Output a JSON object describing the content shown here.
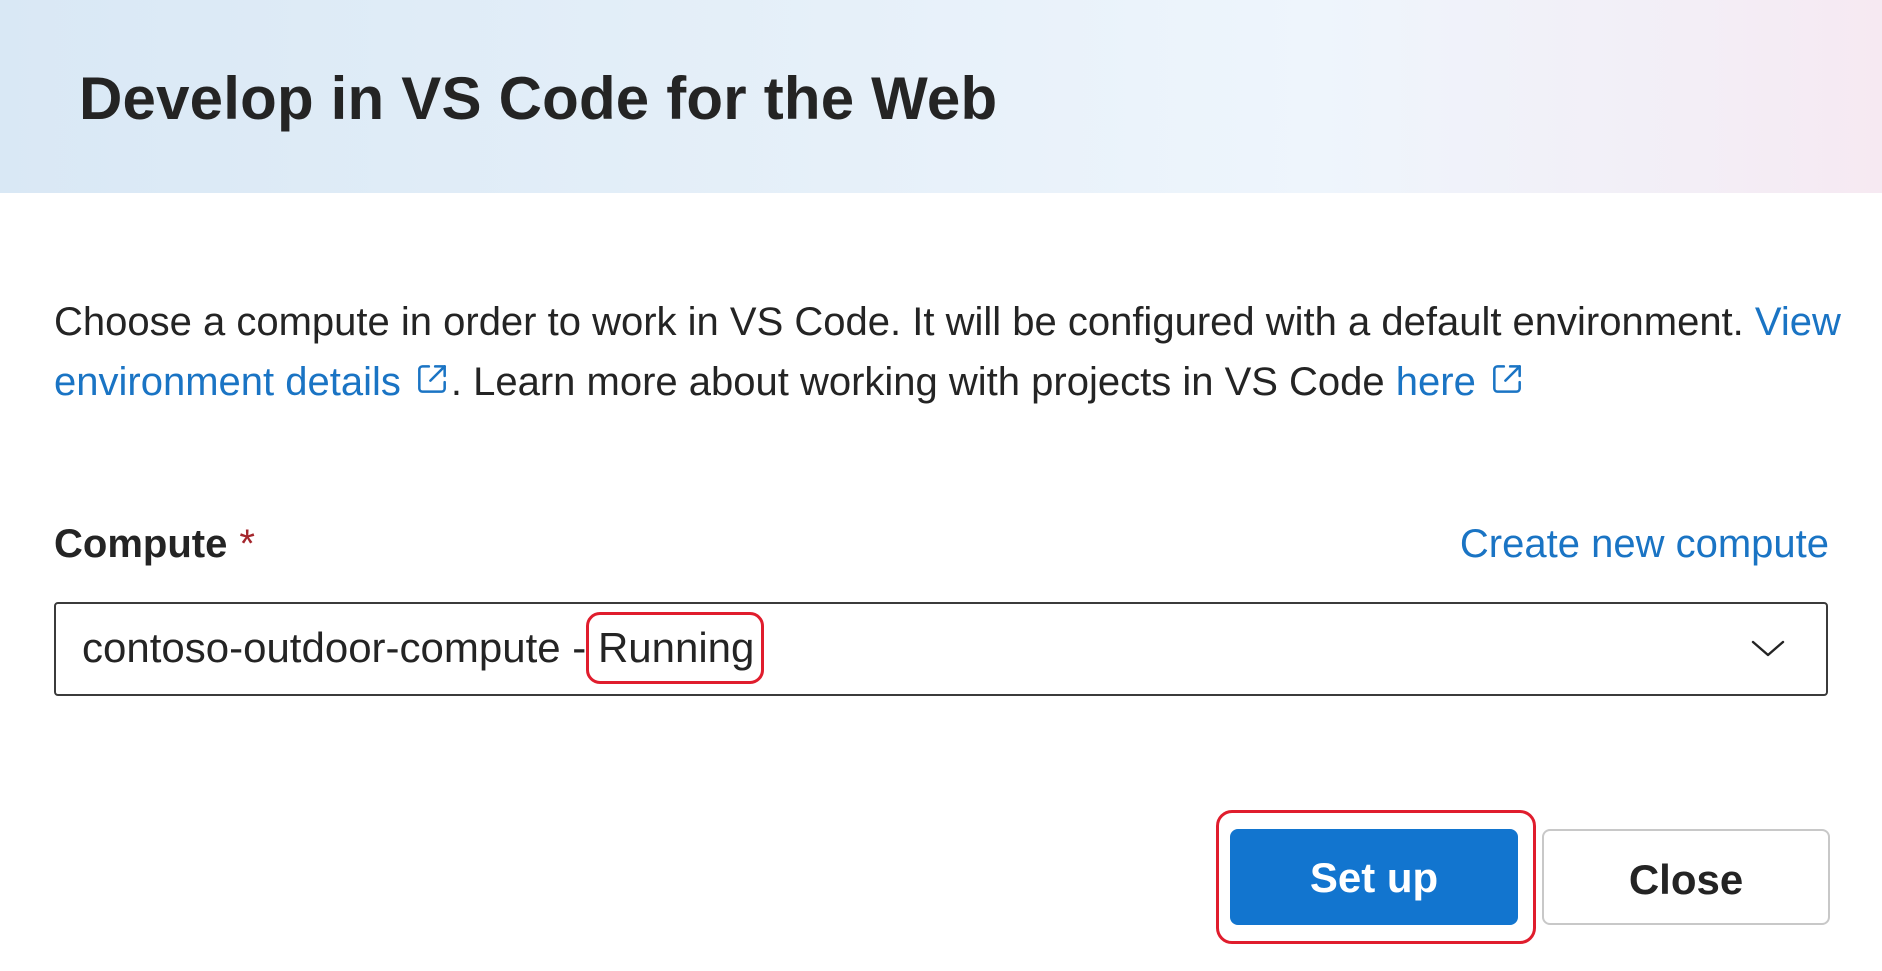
{
  "dialog": {
    "title": "Develop in VS Code for the Web",
    "description": {
      "text_1": "Choose a compute in order to work in VS Code. It will be configured with a default environment. ",
      "link_1": "View environment details",
      "text_2": ". Learn more about working with projects in VS Code ",
      "link_2": "here"
    },
    "compute": {
      "label": "Compute",
      "required_marker": "*",
      "create_link": "Create new compute",
      "selected_name": "contoso-outdoor-compute - ",
      "selected_status": "Running"
    },
    "buttons": {
      "setup_label": "Set up",
      "close_label": "Close"
    }
  },
  "icons": {
    "external_link": "external-link-icon",
    "dropdown": "chevron-down-icon"
  },
  "colors": {
    "link": "#1a74c4",
    "primary_button": "#1275cf",
    "required": "#a4262c",
    "highlight": "#e01d2d"
  }
}
